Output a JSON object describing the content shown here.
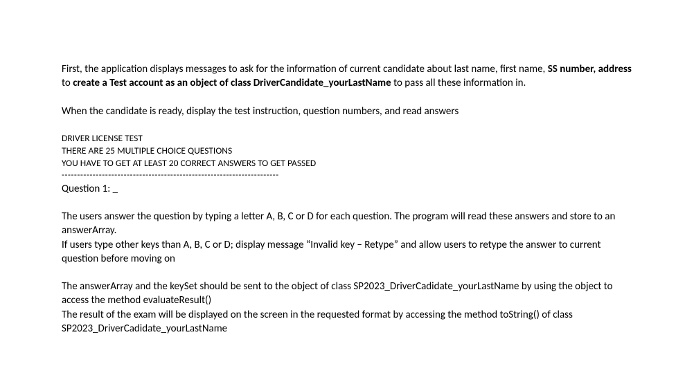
{
  "intro": {
    "p1_part1": "First, the application displays messages to ask for the information of current candidate about last name, first name, ",
    "p1_bold1": "SS number, address",
    "p1_part2": " to ",
    "p1_bold2": "create a Test account as an object of class DriverCandidate_yourLastName",
    "p1_part3": " to pass all these information in."
  },
  "ready": "When the candidate is ready, display the test instruction, question numbers, and read answers",
  "test_header": {
    "title": "DRIVER LICENSE TEST",
    "line2": "THERE ARE 25 MULTIPLE CHOICE QUESTIONS",
    "line3": "YOU HAVE TO GET AT LEAST 20 CORRECT ANSWERS TO GET PASSED",
    "dashes": "----------------------------------------------------------------------"
  },
  "question": "Question 1: _",
  "answer_instr": {
    "p1": "The users answer the question by  typing a letter A, B, C or D for each question. The program will read these answers and store to an answerArray.",
    "p2": "If users type other keys than A, B, C or D; display message “Invalid key – Retype” and allow users to retype the answer to current question before moving on"
  },
  "result_instr": {
    "p1": "The answerArray and the keySet should be sent to the object of class SP2023_DriverCadidate_yourLastName by using the object to access the method evaluateResult()",
    "p2": "The result of the exam will be displayed on the screen in the requested format by accessing the method toString() of class SP2023_DriverCadidate_yourLastName"
  }
}
